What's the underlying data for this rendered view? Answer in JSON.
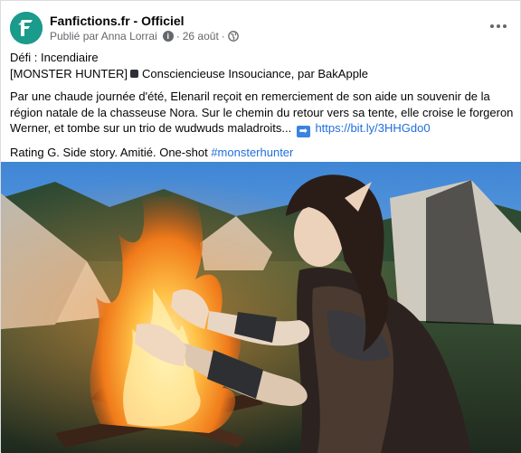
{
  "header": {
    "page_name": "Fanfictions.fr - Officiel",
    "published_by": "Publié par Anna Lorrai",
    "date": "26 août",
    "separator": "·"
  },
  "post": {
    "line1": "Défi : Incendiaire",
    "line2_prefix": "[MONSTER HUNTER]",
    "line2_suffix": "Consciencieuse Insouciance, par BakApple",
    "para": "Par une chaude journée d'été, Elenaril reçoit en remerciement de son aide un souvenir de la région natale de la chasseuse Nora. Sur le chemin du retour vers sa tente, elle croise le forgeron Werner, et tombe sur un trio de wudwuds maladroits...",
    "link": "https://bit.ly/3HHGdo0",
    "rating_text": "Rating G. Side story. Amitié. One-shot",
    "hashtag": "#monsterhunter"
  },
  "image": {
    "subject": "elf-woman-casting-fire-spell-by-campfire"
  },
  "icons": [
    "avatar-logo-icon",
    "info-icon",
    "globe-icon",
    "more-icon",
    "black-square-icon",
    "arrow-right-icon"
  ],
  "colors": {
    "brand": "#1a9b8c",
    "link": "#216fdb",
    "meta": "#65676b"
  }
}
